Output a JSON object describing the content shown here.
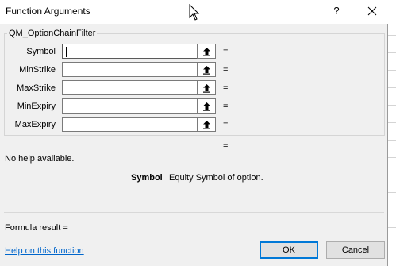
{
  "dialog": {
    "title": "Function Arguments",
    "help_symbol": "?"
  },
  "function_name": "QM_OptionChainFilter",
  "arguments": [
    {
      "label": "Symbol",
      "value": "",
      "equals": "="
    },
    {
      "label": "MinStrike",
      "value": "",
      "equals": "="
    },
    {
      "label": "MaxStrike",
      "value": "",
      "equals": "="
    },
    {
      "label": "MinExpiry",
      "value": "",
      "equals": "="
    },
    {
      "label": "MaxExpiry",
      "value": "",
      "equals": "="
    }
  ],
  "result_equals": "=",
  "help_text": "No help available.",
  "argument_help": {
    "name": "Symbol",
    "description": "Equity Symbol of option."
  },
  "formula_result_label": "Formula result =",
  "help_link": "Help on this function",
  "buttons": {
    "ok": "OK",
    "cancel": "Cancel"
  },
  "icons": {
    "close": "close-icon",
    "collapse": "collapse-dialog-icon",
    "cursor": "mouse-cursor-icon"
  },
  "colors": {
    "dialog_bg": "#f0f0f0",
    "link": "#0066cc",
    "default_button_border": "#0078d7"
  }
}
